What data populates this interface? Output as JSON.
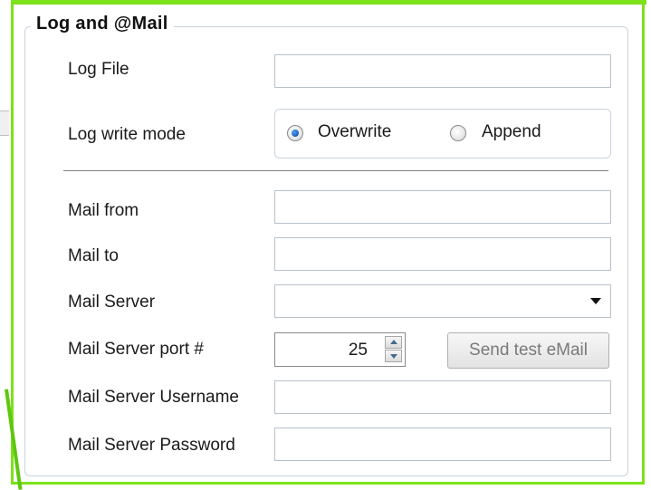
{
  "group": {
    "title": "Log and @Mail"
  },
  "log_file": {
    "label": "Log File",
    "value": ""
  },
  "log_write_mode": {
    "label": "Log write mode",
    "options": [
      {
        "label": "Overwrite",
        "selected": true
      },
      {
        "label": "Append",
        "selected": false
      }
    ]
  },
  "mail_from": {
    "label": "Mail from",
    "value": ""
  },
  "mail_to": {
    "label": "Mail to",
    "value": ""
  },
  "mail_server": {
    "label": "Mail Server",
    "value": ""
  },
  "mail_server_port": {
    "label": "Mail Server port #",
    "value": "25"
  },
  "send_test_button": {
    "label": "Send test eMail",
    "enabled": false
  },
  "mail_server_username": {
    "label": "Mail Server Username",
    "value": ""
  },
  "mail_server_password": {
    "label": "Mail Server Password",
    "value": ""
  },
  "colors": {
    "annotation_border": "#7ce21a",
    "groupbox_border": "#c9d3dc",
    "disabled_text": "#7a7a7a"
  }
}
